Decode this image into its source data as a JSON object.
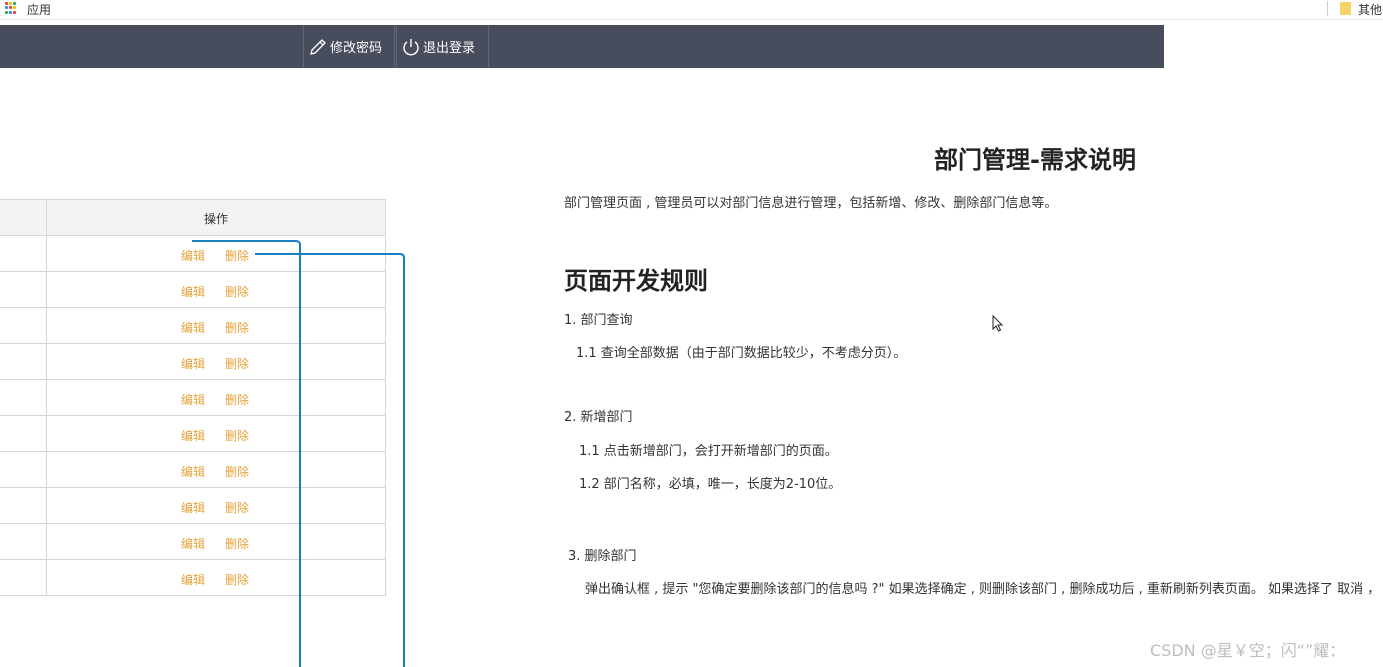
{
  "browser": {
    "apps_label": "应用",
    "other_bookmarks_label": "其他书签"
  },
  "header": {
    "change_password_label": "修改密码",
    "logout_label": "退出登录"
  },
  "table": {
    "operation_header": "操作",
    "rows": [
      {
        "edit": "编辑",
        "delete": "删除"
      },
      {
        "edit": "编辑",
        "delete": "删除"
      },
      {
        "edit": "编辑",
        "delete": "删除"
      },
      {
        "edit": "编辑",
        "delete": "删除"
      },
      {
        "edit": "编辑",
        "delete": "删除"
      },
      {
        "edit": "编辑",
        "delete": "删除"
      },
      {
        "edit": "编辑",
        "delete": "删除"
      },
      {
        "edit": "编辑",
        "delete": "删除"
      },
      {
        "edit": "编辑",
        "delete": "删除"
      },
      {
        "edit": "编辑",
        "delete": "删除"
      }
    ]
  },
  "doc": {
    "title": "部门管理-需求说明",
    "intro": "部门管理页面 , 管理员可以对部门信息进行管理，包括新增、修改、删除部门信息等。",
    "rules_heading": "页面开发规则",
    "s1": "1. 部门查询",
    "s1_1": "1.1  查询全部数据（由于部门数据比较少，不考虑分页）。",
    "s2": "2. 新增部门",
    "s2_1": "1.1 点击新增部门，会打开新增部门的页面。",
    "s2_2": "1.2 部门名称，必填，唯一，长度为2-10位。",
    "s3": "3.  删除部门",
    "s3_1": "弹出确认框 , 提示 \"您确定要删除该部门的信息吗 ?\" 如果选择确定 , 则删除该部门 , 删除成功后 , 重新刷新列表页面。  如果选择了 取消 ，  则"
  },
  "watermark": "CSDN @星￥空；闪“”耀：",
  "colors": {
    "header_bg": "#474d5c",
    "action_link": "#e6a23c",
    "connector": "#1a7fc1"
  }
}
